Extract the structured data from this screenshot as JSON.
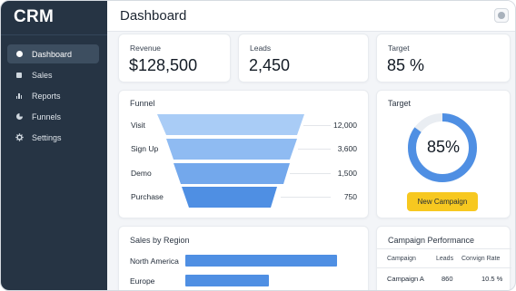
{
  "brand": "CRM",
  "sidebar": {
    "items": [
      {
        "label": "Dashboard",
        "icon": "circle-icon",
        "active": true
      },
      {
        "label": "Sales",
        "icon": "square-icon",
        "active": false
      },
      {
        "label": "Reports",
        "icon": "bar-chart-icon",
        "active": false
      },
      {
        "label": "Funnels",
        "icon": "pie-icon",
        "active": false
      },
      {
        "label": "Settings",
        "icon": "gear-icon",
        "active": false
      }
    ]
  },
  "header": {
    "title": "Dashboard"
  },
  "kpis": [
    {
      "label": "Revenue",
      "value": "$128,500"
    },
    {
      "label": "Leads",
      "value": "2,450"
    },
    {
      "label": "Target",
      "value": "85 %"
    }
  ],
  "funnel": {
    "title": "Funnel",
    "stages": [
      {
        "label": "Visit",
        "value": "12,000",
        "color": "#a9ccf6"
      },
      {
        "label": "Sign Up",
        "value": "3,600",
        "color": "#8fbbf2"
      },
      {
        "label": "Demo",
        "value": "1,500",
        "color": "#73a8ec"
      },
      {
        "label": "Purchase",
        "value": "750",
        "color": "#4f8fe3"
      }
    ]
  },
  "target": {
    "title": "Target",
    "percent": 85,
    "label": "85%",
    "button": "New Campaign",
    "ring_color": "#4f8fe3",
    "track_color": "#e9edf2"
  },
  "sales_by_region": {
    "title": "Sales by Region",
    "rows": [
      {
        "label": "North America",
        "fraction": 1.0
      },
      {
        "label": "Europe",
        "fraction": 0.55
      }
    ]
  },
  "campaign_performance": {
    "title": "Campaign Performance",
    "columns": [
      "Campaign",
      "Leads",
      "Convign Rate"
    ],
    "rows": [
      {
        "campaign": "Campaign A",
        "leads": "860",
        "rate": "10.5 %"
      }
    ]
  },
  "colors": {
    "sidebar_bg": "#263444",
    "accent_blue": "#4f8fe3",
    "button_yellow": "#f7c820"
  }
}
